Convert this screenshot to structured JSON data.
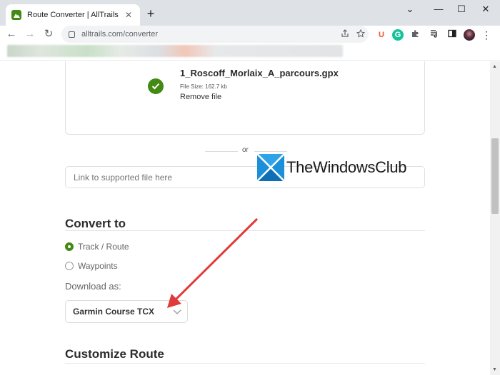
{
  "browser": {
    "tab_title": "Route Converter | AllTrails",
    "tab_close": "✕",
    "new_tab": "+",
    "url": "alltrails.com/converter",
    "window_controls": {
      "minimize": "—",
      "maximize": "☐",
      "close": "✕",
      "collapse": "⌄"
    },
    "nav": {
      "back": "←",
      "forward": "→",
      "reload": "↻"
    },
    "extensions": [
      {
        "name": "ublock-icon",
        "glyph": "U",
        "color": "#e8552d"
      },
      {
        "name": "grammarly-icon",
        "glyph": "G",
        "color": "#15c39a"
      },
      {
        "name": "puzzle-icon",
        "glyph": "✱",
        "color": "#5f6368"
      },
      {
        "name": "media-icon",
        "glyph": "♫",
        "color": "#5f6368"
      },
      {
        "name": "sidepanel-icon",
        "glyph": "◧",
        "color": "#5f6368"
      }
    ],
    "menu": "⋮"
  },
  "upload": {
    "file_name": "1_Roscoff_Morlaix_A_parcours.gpx",
    "file_size": "File Size: 162.7 kb",
    "remove_label": "Remove file"
  },
  "divider_label": "or",
  "link_input": {
    "placeholder": "Link to supported file here",
    "value": ""
  },
  "watermark": {
    "text": "TheWindowsClub"
  },
  "convert": {
    "title": "Convert to",
    "options": [
      {
        "label": "Track / Route",
        "selected": true
      },
      {
        "label": "Waypoints",
        "selected": false
      }
    ],
    "download_label": "Download as:",
    "download_value": "Garmin Course TCX"
  },
  "customize": {
    "title": "Customize Route"
  },
  "colors": {
    "accent": "#428a13",
    "arrow": "#e03b3b"
  }
}
